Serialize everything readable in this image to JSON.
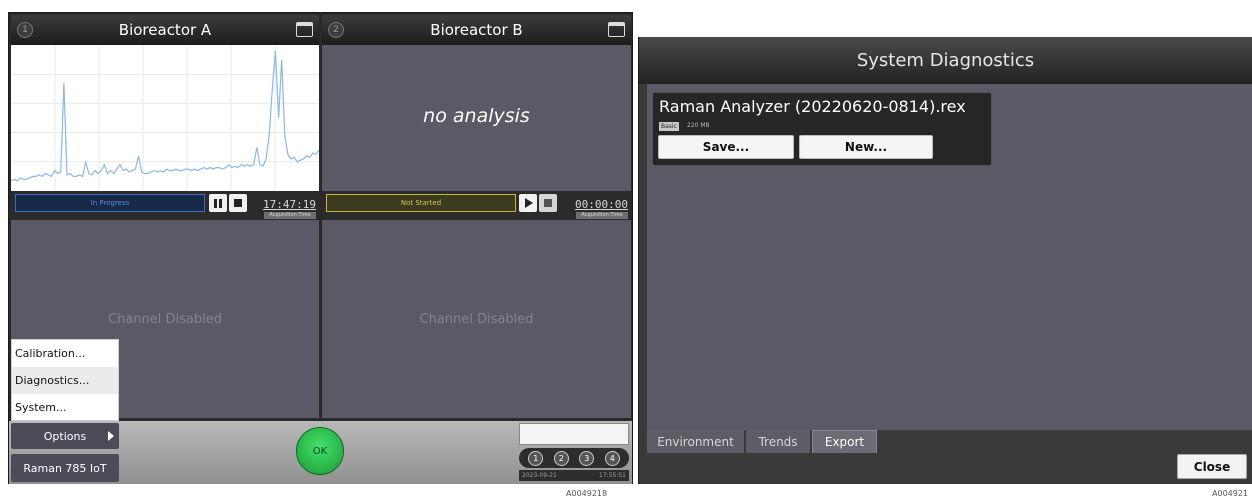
{
  "left_screen": {
    "channels": [
      {
        "number": "1",
        "title": "Bioreactor A",
        "status_text": "In Progress",
        "status_color": "#3a6fc4",
        "time": "17:47:19",
        "time_label": "Acquisition Time",
        "spectrum": {
          "line_color": "#8db7e4",
          "trace_y": [
            0.93,
            0.92,
            0.93,
            0.91,
            0.92,
            0.92,
            0.91,
            0.9,
            0.9,
            0.89,
            0.9,
            0.88,
            0.89,
            0.9,
            0.86,
            0.88,
            0.87,
            0.26,
            0.89,
            0.88,
            0.9,
            0.9,
            0.89,
            0.9,
            0.8,
            0.88,
            0.89,
            0.86,
            0.88,
            0.86,
            0.82,
            0.88,
            0.86,
            0.88,
            0.85,
            0.82,
            0.86,
            0.85,
            0.87,
            0.86,
            0.85,
            0.76,
            0.87,
            0.88,
            0.88,
            0.87,
            0.86,
            0.87,
            0.86,
            0.87,
            0.85,
            0.86,
            0.86,
            0.85,
            0.86,
            0.86,
            0.85,
            0.85,
            0.86,
            0.85,
            0.86,
            0.85,
            0.84,
            0.85,
            0.84,
            0.85,
            0.84,
            0.84,
            0.85,
            0.84,
            0.82,
            0.84,
            0.83,
            0.84,
            0.82,
            0.83,
            0.82,
            0.83,
            0.82,
            0.7,
            0.82,
            0.83,
            0.78,
            0.62,
            0.3,
            0.04,
            0.5,
            0.1,
            0.62,
            0.75,
            0.78,
            0.77,
            0.8,
            0.79,
            0.78,
            0.76,
            0.77,
            0.74,
            0.75,
            0.72
          ]
        }
      },
      {
        "number": "2",
        "title": "Bioreactor B",
        "message": "no analysis",
        "status_text": "Not Started",
        "status_color": "#c9b531",
        "time": "00:00:00",
        "time_label": "Acquisition Time"
      }
    ],
    "disabled_text": "Channel Disabled",
    "menu": {
      "items": [
        "Calibration...",
        "Diagnostics...",
        "System..."
      ],
      "options_label": "Options"
    },
    "device_label": "Raman 785 IoT",
    "ok_label": "OK",
    "indicator": {
      "dots": [
        "1",
        "2",
        "3",
        "4"
      ],
      "date": "2023-09-21",
      "time": "17:55:51"
    },
    "caption": "A0049218"
  },
  "right_screen": {
    "title": "System Diagnostics",
    "file": {
      "name": "Raman Analyzer (20220620-0814).rex",
      "badge": "Basic",
      "size": "220 MB",
      "save_label": "Save...",
      "new_label": "New..."
    },
    "tabs": [
      "Environment",
      "Trends",
      "Export"
    ],
    "active_tab": "Export",
    "close_label": "Close",
    "caption": "A004921"
  }
}
